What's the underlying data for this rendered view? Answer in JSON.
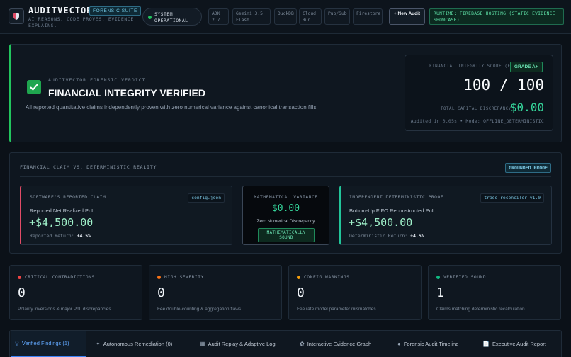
{
  "header": {
    "brand": "AUDITVECTOR",
    "suite_badge": "FORENSIC SUITE",
    "tagline": "AI REASONS. CODE PROVES. EVIDENCE EXPLAINS.",
    "status": "SYSTEM OPERATIONAL",
    "tech": [
      "ADK 2.7",
      "Gemini 3.5 Flash",
      "DuckDB",
      "Cloud Run",
      "Pub/Sub",
      "Firestore"
    ],
    "new_audit": "+ New Audit",
    "runtime": "RUNTIME: FIREBASE HOSTING (STATIC EVIDENCE SHOWCASE)"
  },
  "verdict": {
    "kicker": "AUDITVECTOR FORENSIC VERDICT",
    "title": "FINANCIAL INTEGRITY VERIFIED",
    "description": "All reported quantitative claims independently proven with zero numerical variance against canonical transaction fills.",
    "fis_label": "FINANCIAL INTEGRITY SCORE (FIS)",
    "grade": "GRADE A+",
    "score": "100 / 100",
    "discrepancy_label": "TOTAL CAPITAL DISCREPANCY",
    "discrepancy_value": "$0.00",
    "audited": "Audited in 0.05s • Mode: OFFLINE_DETERMINISTIC"
  },
  "comparison": {
    "title": "FINANCIAL CLAIM VS. DETERMINISTIC REALITY",
    "badge": "GROUNDED PROOF",
    "claim": {
      "label": "SOFTWARE'S REPORTED CLAIM",
      "source": "config.json",
      "metric": "Reported Net Realized PnL",
      "value": "+$4,500.00",
      "return_label": "Reported Return:",
      "return_value": "+4.5%"
    },
    "variance": {
      "label": "MATHEMATICAL VARIANCE",
      "value": "$0.00",
      "sub": "Zero Numerical Discrepancy",
      "badge": "MATHEMATICALLY SOUND"
    },
    "proof": {
      "label": "INDEPENDENT DETERMINISTIC PROOF",
      "source": "trade_reconciler_v1.0",
      "metric": "Bottom-Up FIFO Reconstructed PnL",
      "value": "+$4,500.00",
      "return_label": "Deterministic Return:",
      "return_value": "+4.5%"
    }
  },
  "stats": [
    {
      "label": "CRITICAL CONTRADICTIONS",
      "value": "0",
      "desc": "Polarity inversions & major PnL discrepancies",
      "color": "#ef4444"
    },
    {
      "label": "HIGH SEVERITY",
      "value": "0",
      "desc": "Fee double-counting & aggregation flaws",
      "color": "#f97316"
    },
    {
      "label": "CONFIG WARNINGS",
      "value": "0",
      "desc": "Fee rate model parameter mismatches",
      "color": "#f59e0b"
    },
    {
      "label": "VERIFIED SOUND",
      "value": "1",
      "desc": "Claims matching deterministic recalculation",
      "color": "#10b981"
    }
  ],
  "tabs": [
    {
      "label": "Verified Findings (1)",
      "icon": "search-icon"
    },
    {
      "label": "Autonomous Remediation (0)",
      "icon": "wand-icon"
    },
    {
      "label": "Audit Replay & Adaptive Log",
      "icon": "replay-icon"
    },
    {
      "label": "Interactive Evidence Graph",
      "icon": "graph-icon"
    },
    {
      "label": "Forensic Audit Timeline",
      "icon": "timeline-icon"
    },
    {
      "label": "Executive Audit Report",
      "icon": "document-icon"
    }
  ]
}
